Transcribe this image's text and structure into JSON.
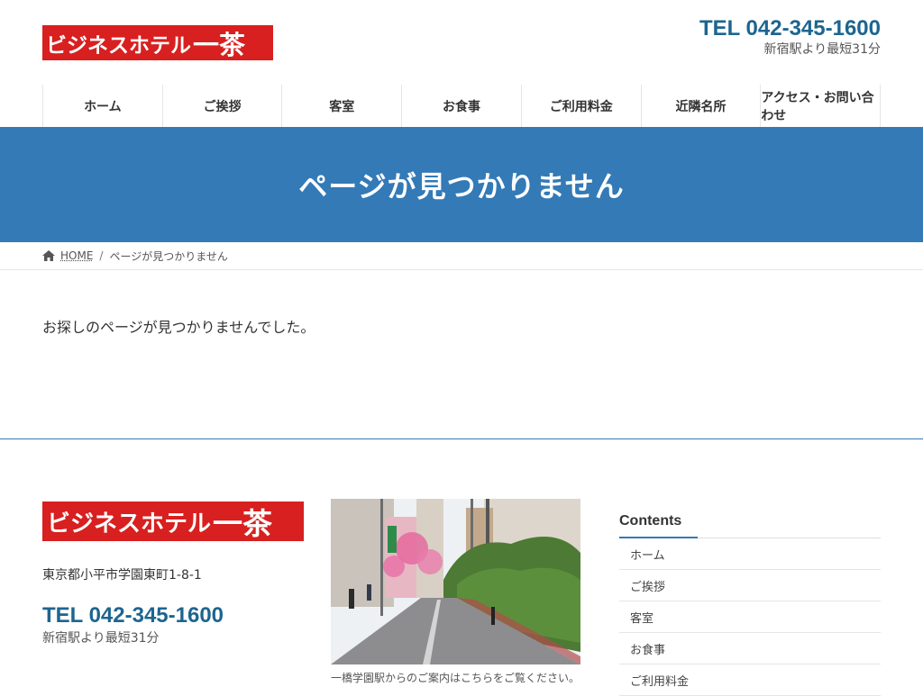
{
  "header": {
    "logo_text": "ビジネスホテル",
    "logo_kanji": "一茶",
    "tel": "TEL 042-345-1600",
    "tel_sub": "新宿駅より最短31分"
  },
  "nav": {
    "items": [
      "ホーム",
      "ご挨拶",
      "客室",
      "お食事",
      "ご利用料金",
      "近隣名所",
      "アクセス・お問い合わせ"
    ]
  },
  "page_title": "ページが見つかりません",
  "breadcrumb": {
    "home": "HOME",
    "separator": "/",
    "current": "ページが見つかりません"
  },
  "main": {
    "message": "お探しのページが見つかりませんでした。"
  },
  "footer": {
    "logo_text": "ビジネスホテル",
    "logo_kanji": "一茶",
    "address": "東京都小平市学園東町1-8-1",
    "tel": "TEL 042-345-1600",
    "tel_sub": "新宿駅より最短31分",
    "photo_caption": "一橋学園駅からのご案内はこちらをご覧ください。",
    "contents_title": "Contents",
    "contents_items": [
      "ホーム",
      "ご挨拶",
      "客室",
      "お食事",
      "ご利用料金"
    ]
  },
  "colors": {
    "brand_red": "#d7201f",
    "accent_blue": "#337ab7",
    "tel_blue": "#1d6590"
  }
}
